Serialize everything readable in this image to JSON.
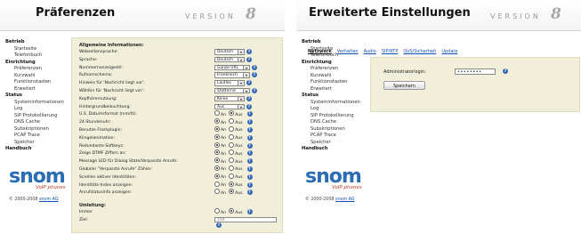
{
  "left": {
    "title": "Präferenzen",
    "version_word": "VERSION",
    "version_num": "8",
    "nav": [
      {
        "head": "Betrieb",
        "items": [
          "Startseite",
          "Telefonbuch"
        ]
      },
      {
        "head": "Einrichtung",
        "items": [
          "Präferenzen",
          "Kurzwahl",
          "Funktionstasten",
          "Erweitert"
        ]
      },
      {
        "head": "Status",
        "items": [
          "Systeminformationen",
          "Log",
          "SIP Protokollierung",
          "DNS Cache",
          "Subskriptionen",
          "PCAP Trace",
          "Speicher"
        ]
      },
      {
        "head": "Handbuch",
        "items": []
      }
    ],
    "logo": {
      "main": "snom",
      "sub": "VoIP phones"
    },
    "copyright": {
      "text": "© 2000-2008 ",
      "link": "snom AG"
    },
    "section1_title": "Allgemeine Informationen:",
    "rows": [
      {
        "label": "Webseitensprache:",
        "type": "select",
        "value": "Deutsch"
      },
      {
        "label": "Sprache:",
        "type": "select",
        "value": "Deutsch"
      },
      {
        "label": "Nummernanzeigestil:",
        "type": "select",
        "value": "Ganze URL"
      },
      {
        "label": "Rufnomschema:",
        "type": "select",
        "value": "Frankreich"
      },
      {
        "label": "Hinweis für 'Nachricht liegt vor':",
        "type": "select",
        "value": "Lautlos"
      },
      {
        "label": "Wähltin für 'Nachricht liegt vor':",
        "type": "select",
        "value": "Stotternd"
      },
      {
        "label": "Kopfhörernutzung:",
        "type": "select",
        "value": "Keine"
      },
      {
        "label": "Hintergrundbeleuchtung:",
        "type": "select",
        "value": "Aus"
      },
      {
        "label": "U.S. Datumsformat (mm/tt):",
        "type": "radio",
        "value": "Aus"
      },
      {
        "label": "24-Stundenuhr:",
        "type": "radio",
        "value": "An"
      },
      {
        "label": "Benutze Flashplugin:",
        "type": "radio",
        "value": "An"
      },
      {
        "label": "Klingelanimation:",
        "type": "radio",
        "value": "An"
      },
      {
        "label": "Redundante Softkeys:",
        "type": "radio",
        "value": "An"
      },
      {
        "label": "Zeige DTMF Ziffern an:",
        "type": "radio",
        "value": "An"
      },
      {
        "label": "Message LED für Dialog State/Verpasste Anrufe:",
        "type": "radio",
        "value": "An"
      },
      {
        "label": "Globaler \"Verpasste Anrufe\" Zähler:",
        "type": "radio",
        "value": "An"
      },
      {
        "label": "Scrollen aktiver Identitäten:",
        "type": "radio",
        "value": "An"
      },
      {
        "label": "Identitäts-Index anzeigen:",
        "type": "radio",
        "value": "Aus"
      },
      {
        "label": "Anrufstatusinfo anzeigen:",
        "type": "radio",
        "value": "Aus"
      }
    ],
    "section2_title": "Umleitung:",
    "rows2": [
      {
        "label": "Immer",
        "type": "radio",
        "value": "Aus"
      },
      {
        "label": "Ziel:",
        "type": "text",
        "value": "159"
      }
    ],
    "radio_on_label": "An",
    "radio_off_label": "Aus",
    "help_glyph": "?"
  },
  "right": {
    "title": "Erweiterte Einstellungen",
    "version_word": "VERSION",
    "version_num": "8",
    "nav": [
      {
        "head": "Betrieb",
        "items": [
          "Startseite",
          "Telefonbuch"
        ]
      },
      {
        "head": "Einrichtung",
        "items": [
          "Präferenzen",
          "Kurzwahl",
          "Funktionstasten",
          "Erweitert"
        ]
      },
      {
        "head": "Status",
        "items": [
          "Systeminformationen",
          "Log",
          "SIP Protokollierung",
          "DNS Cache",
          "Subskriptionen",
          "PCAP Trace",
          "Speicher"
        ]
      },
      {
        "head": "Handbuch",
        "items": []
      }
    ],
    "logo": {
      "main": "snom",
      "sub": "VoIP phones"
    },
    "copyright": {
      "text": "© 2000-2008 ",
      "link": "snom AG"
    },
    "tabs": [
      "Netzwerk",
      "Verhalten",
      "Audio",
      "SIP/RTP",
      "QoS/Sicherheit",
      "Update"
    ],
    "admin_label": "Administratorlogin:",
    "admin_value": "••••••••",
    "save_label": "Speichern",
    "help_glyph": "?"
  },
  "colors": {
    "accent_blue": "#2a6db3",
    "content_bg": "#f1efd9",
    "logo_red": "#c0392b"
  }
}
